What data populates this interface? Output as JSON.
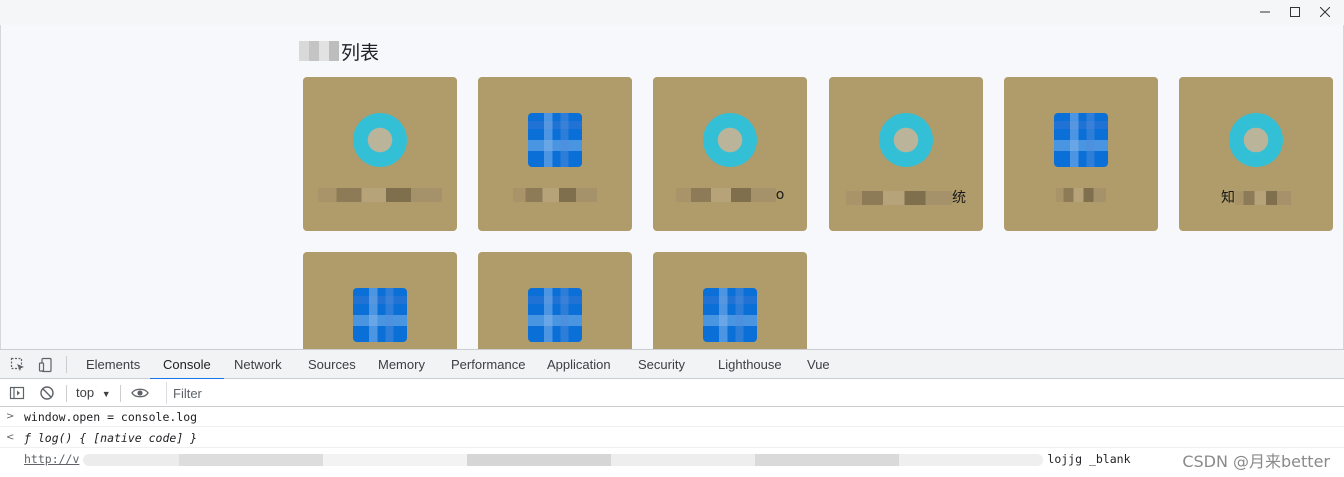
{
  "window": {
    "minimize_icon": "minimize-icon",
    "maximize_icon": "maximize-icon",
    "close_icon": "close-icon"
  },
  "page": {
    "title_visible": "列表",
    "cards": [
      {
        "icon": "round-app-icon",
        "icon_color": "#33c0d6",
        "label_visible": ""
      },
      {
        "icon": "square-app-icon",
        "icon_color": "#0a6fd6",
        "label_visible": ""
      },
      {
        "icon": "round-app-icon",
        "icon_color": "#33c0d6",
        "label_visible": "o"
      },
      {
        "icon": "round-app-icon",
        "icon_color": "#33c0d6",
        "label_visible": "统"
      },
      {
        "icon": "square-app-icon",
        "icon_color": "#0a6fd6",
        "label_visible": ""
      },
      {
        "icon": "round-app-icon",
        "icon_color": "#33c0d6",
        "label_visible": "知"
      },
      {
        "icon": "square-app-icon",
        "icon_color": "#0a6fd6",
        "label_visible": ""
      },
      {
        "icon": "square-app-icon",
        "icon_color": "#0a6fd6",
        "label_visible": ""
      },
      {
        "icon": "square-app-icon",
        "icon_color": "#0a6fd6",
        "label_visible": ""
      }
    ],
    "card_color": "#b09b6a"
  },
  "devtools": {
    "tabs": [
      "Elements",
      "Console",
      "Network",
      "Sources",
      "Memory",
      "Performance",
      "Application",
      "Security",
      "Lighthouse",
      "Vue"
    ],
    "active_tab": "Console",
    "context": "top",
    "filter_placeholder": "Filter",
    "console": {
      "input": "window.open = console.log",
      "result": "ƒ log() { [native code] }",
      "log_prefix": "http://v",
      "log_fragment": "lojjg",
      "log_suffix": "_blank"
    },
    "accent": "#1a73e8"
  },
  "watermark": "CSDN @月来better"
}
